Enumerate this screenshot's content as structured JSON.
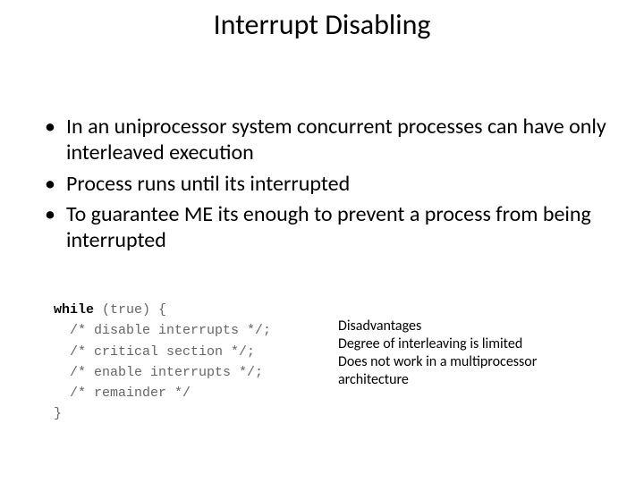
{
  "title": "Interrupt Disabling",
  "bullets": [
    "In an uniprocessor system concurrent processes can have only interleaved execution",
    "Process runs until its interrupted",
    "To guarantee ME its enough to prevent a process from being interrupted"
  ],
  "code": {
    "kw_while": "while",
    "cond": " (true) {",
    "l2": "  /* disable interrupts */;",
    "l3": "  /* critical section */;",
    "l4": "  /* enable interrupts */;",
    "l5": "  /* remainder */",
    "l6": "}"
  },
  "disadvantages": {
    "heading": "Disadvantages",
    "line1": "Degree of interleaving is limited",
    "line2": "Does not work in a multiprocessor architecture"
  }
}
